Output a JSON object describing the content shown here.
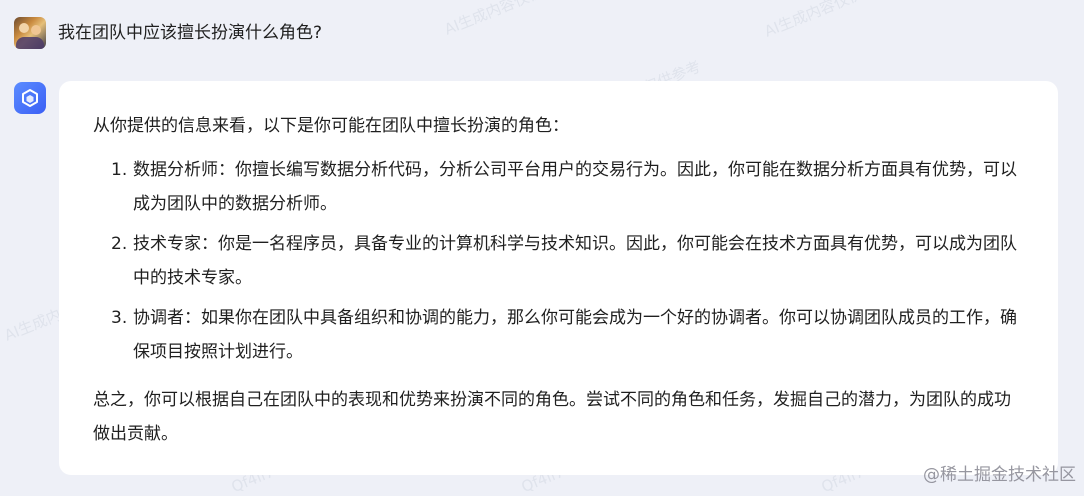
{
  "user": {
    "question": "我在团队中应该擅长扮演什么角色?"
  },
  "answer": {
    "intro": "从你提供的信息来看，以下是你可能在团队中擅长扮演的角色：",
    "items": [
      {
        "num": "1.",
        "text": "数据分析师：你擅长编写数据分析代码，分析公司平台用户的交易行为。因此，你可能在数据分析方面具有优势，可以成为团队中的数据分析师。"
      },
      {
        "num": "2.",
        "text": "技术专家：你是一名程序员，具备专业的计算机科学与技术知识。因此，你可能会在技术方面具有优势，可以成为团队中的技术专家。"
      },
      {
        "num": "3.",
        "text": "协调者：如果你在团队中具备组织和协调的能力，那么你可能会成为一个好的协调者。你可以协调团队成员的工作，确保项目按照计划进行。"
      }
    ],
    "summary": "总之，你可以根据自己在团队中的表现和优势来扮演不同的角色。尝试不同的角色和任务，发掘自己的潜力，为团队的成功做出贡献。"
  },
  "watermark": {
    "text": "AI生成内容仅供参考",
    "id": "Qf4ll7Li"
  },
  "footer": {
    "source": "@稀土掘金技术社区"
  },
  "icons": {
    "user_avatar": "user-avatar-image",
    "bot_avatar": "assistant-logo-icon"
  },
  "colors": {
    "page_background": "#eef0f7",
    "card_background": "#ffffff",
    "bot_avatar": "#3b5ff5"
  }
}
